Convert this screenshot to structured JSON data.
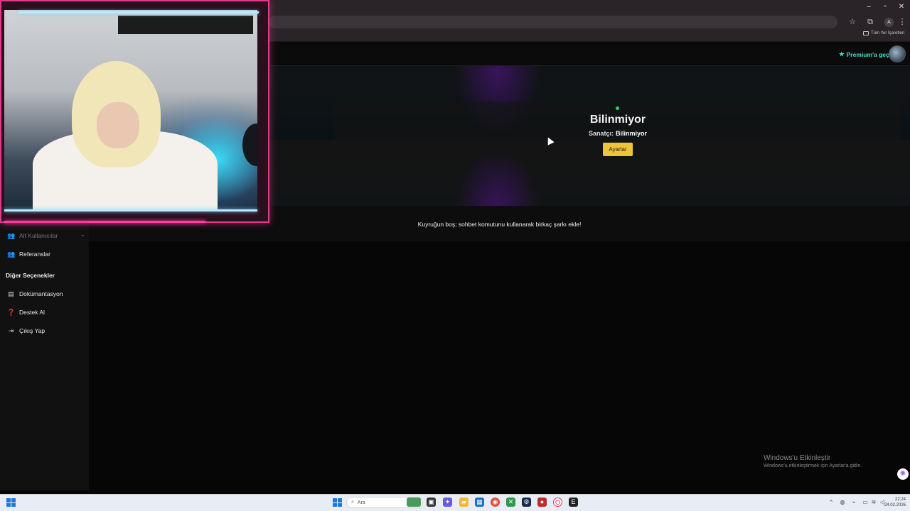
{
  "browser": {
    "bookmarks_all": "Tüm Yer İşaretleri",
    "profile_initial": "A"
  },
  "header": {
    "premium_label": "Premium'a geç"
  },
  "now_playing": {
    "title": "Bilinmiyor",
    "artist_label": "Sanatçı:",
    "artist_value": "Bilinmiyor",
    "settings_label": "Ayarlar"
  },
  "queue": {
    "empty_message": "Kuyruğun boş; sohbet komutunu kullanarak birkaç şarkı ekle!"
  },
  "sidebar": {
    "items": [
      {
        "label": "Alt Kullanıcılar",
        "icon": "users-group-icon"
      },
      {
        "label": "Referanslar",
        "icon": "users-icon"
      }
    ],
    "section_heading": "Diğer Seçenekler",
    "other_items": [
      {
        "label": "Dokümantasyon",
        "icon": "book-icon"
      },
      {
        "label": "Destek Al",
        "icon": "question-icon"
      },
      {
        "label": "Çıkış Yap",
        "icon": "sign-out-icon"
      }
    ]
  },
  "windows": {
    "activate_title": "Windows'u Etkinleştir",
    "activate_sub": "Windows'u etkinleştirmek için Ayarlar'a gidin."
  },
  "taskbar": {
    "search_placeholder": "Ara",
    "time": "22:24",
    "date": "24.02.2026"
  },
  "colors": {
    "accent_teal": "#3fe0d0",
    "settings_button": "#f0c43a",
    "status_dot": "#2bd46a",
    "webcam_border": "#e13a8a"
  }
}
